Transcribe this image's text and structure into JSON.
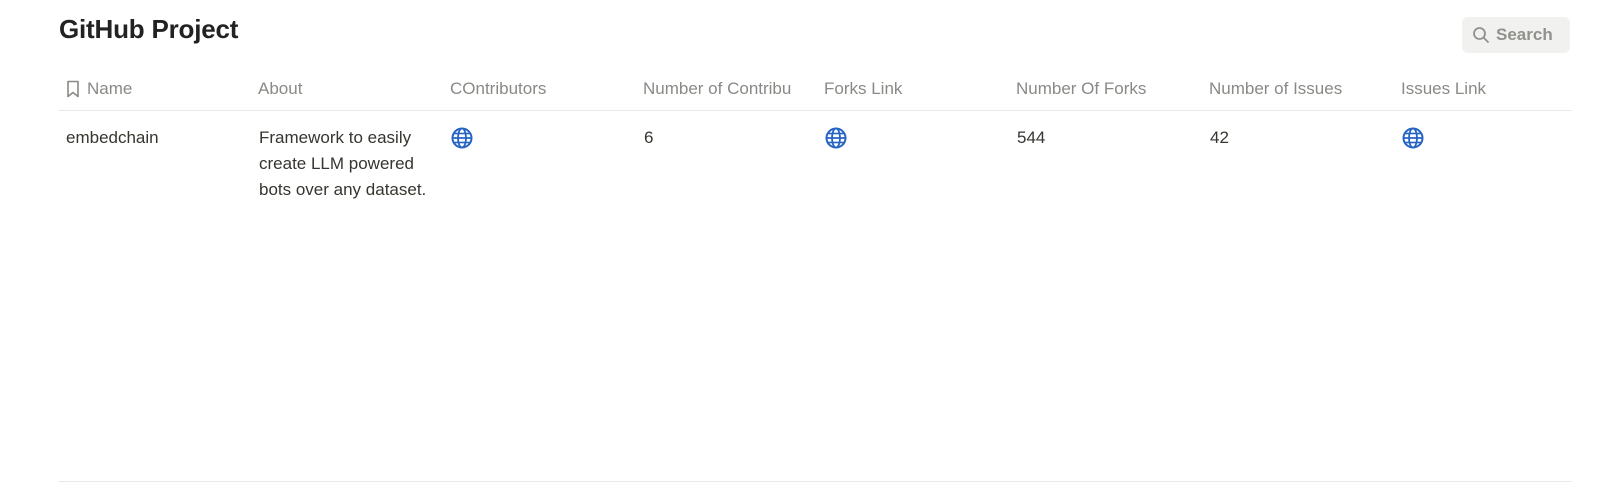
{
  "title": "GitHub Project",
  "search": {
    "label": "Search"
  },
  "columns": [
    {
      "label": "Name",
      "icon": "bookmark-icon"
    },
    {
      "label": "About"
    },
    {
      "label": "COntributors"
    },
    {
      "label": "Number of Contribu"
    },
    {
      "label": "Forks Link"
    },
    {
      "label": "Number Of Forks"
    },
    {
      "label": "Number of Issues"
    },
    {
      "label": "Issues Link"
    }
  ],
  "rows": [
    {
      "name": "embedchain",
      "about": "Framework to easily create LLM powered bots over any dataset.",
      "contributors_link_icon": "globe-icon",
      "number_of_contributors": "6",
      "forks_link_icon": "globe-icon",
      "number_of_forks": "544",
      "number_of_issues": "42",
      "issues_link_icon": "globe-icon"
    }
  ],
  "colors": {
    "link_icon": "#2664c4",
    "header_text": "#8a8985",
    "body_text": "#37352f"
  }
}
